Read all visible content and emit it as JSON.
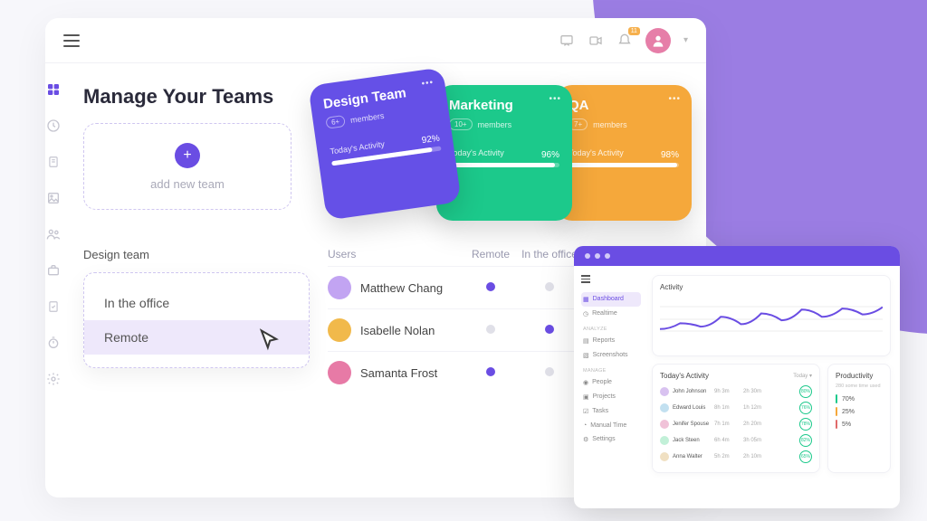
{
  "colors": {
    "accent": "#6a4de3",
    "green": "#1cc98b",
    "orange": "#f5a83b",
    "yellow": "#f6b04d"
  },
  "topbar": {
    "notification_badge": "11"
  },
  "title": "Manage Your Teams",
  "add_team": {
    "label": "add new team"
  },
  "team_cards": [
    {
      "name": "Design Team",
      "member_badge": "6+",
      "members_label": "members",
      "activity_label": "Today's Activity",
      "percent": "92%"
    },
    {
      "name": "Marketing",
      "member_badge": "10+",
      "members_label": "members",
      "activity_label": "Today's Activity",
      "percent": "96%"
    },
    {
      "name": "QA",
      "member_badge": "7+",
      "members_label": "members",
      "activity_label": "Today's Activity",
      "percent": "98%"
    }
  ],
  "location_panel": {
    "title": "Design team",
    "options": {
      "in_office": "In the office",
      "remote": "Remote"
    }
  },
  "users_panel": {
    "headers": {
      "users": "Users",
      "remote": "Remote",
      "office": "In the office"
    },
    "rows": [
      {
        "name": "Matthew Chang",
        "remote": true,
        "office": false,
        "avatar": "#c2a4f2"
      },
      {
        "name": "Isabelle Nolan",
        "remote": false,
        "office": true,
        "avatar": "#f1b94b"
      },
      {
        "name": "Samanta Frost",
        "remote": true,
        "office": false,
        "avatar": "#e77aa6"
      }
    ]
  },
  "mini": {
    "nav": {
      "dashboard": "Dashboard",
      "realtime": "Realtime",
      "sec_analyze": "ANALYZE",
      "reports": "Reports",
      "screenshots": "Screenshots",
      "sec_manage": "MANAGE",
      "people": "People",
      "projects": "Projects",
      "tasks": "Tasks",
      "manual_time": "Manual Time",
      "settings": "Settings"
    },
    "activity_title": "Activity",
    "today_title": "Today's Activity",
    "today_period": "Today",
    "productivity_title": "Productivity",
    "productivity_sub": "280 some time used",
    "today_rows": [
      {
        "name": "John Johnson",
        "t1": "9h 3m",
        "t2": "2h 30m",
        "pct": "80%",
        "avatar": "#d8c2f0"
      },
      {
        "name": "Edward Louis",
        "t1": "8h 1m",
        "t2": "1h 12m",
        "pct": "76%",
        "avatar": "#c2e0f0"
      },
      {
        "name": "Jenifer Spouse",
        "t1": "7h 1m",
        "t2": "2h 20m",
        "pct": "78%",
        "avatar": "#f0c2d8"
      },
      {
        "name": "Jack Steen",
        "t1": "6h 4m",
        "t2": "3h 05m",
        "pct": "82%",
        "avatar": "#c2f0d8"
      },
      {
        "name": "Anna Walter",
        "t1": "5h 2m",
        "t2": "2h 10m",
        "pct": "65%",
        "avatar": "#f0e0c2"
      }
    ],
    "productivity_rows": [
      {
        "label": "70%",
        "color": "#1cc98b"
      },
      {
        "label": "25%",
        "color": "#f5a83b"
      },
      {
        "label": "5%",
        "color": "#e06a6a"
      }
    ]
  },
  "chart_data": {
    "type": "line",
    "title": "Activity",
    "x": [
      0,
      1,
      2,
      3,
      4,
      5,
      6,
      7,
      8,
      9,
      10,
      11
    ],
    "values": [
      30,
      42,
      35,
      55,
      40,
      62,
      48,
      70,
      55,
      72,
      60,
      75
    ],
    "ylim": [
      0,
      100
    ]
  }
}
